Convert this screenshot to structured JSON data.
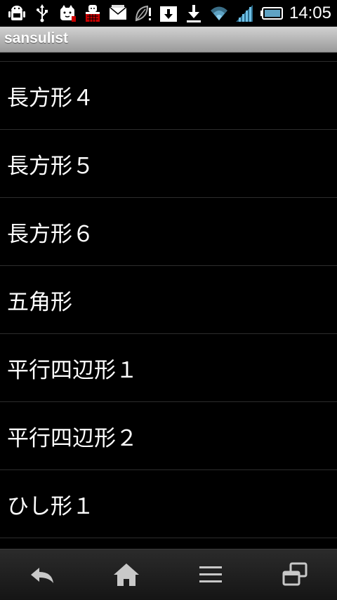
{
  "status_bar": {
    "time": "14:05",
    "icons_left": [
      "android-debug-icon",
      "usb-icon",
      "app-notification-icon",
      "app-notification-icon-2",
      "mail-icon",
      "leaf-alert-icon",
      "download-box-icon",
      "download-icon"
    ],
    "icons_right": [
      "wifi-icon",
      "signal-icon",
      "battery-icon"
    ]
  },
  "title_bar": {
    "title": "sansulist"
  },
  "list": {
    "items": [
      {
        "label": "長方形４"
      },
      {
        "label": "長方形５"
      },
      {
        "label": "長方形６"
      },
      {
        "label": "五角形"
      },
      {
        "label": "平行四辺形１"
      },
      {
        "label": "平行四辺形２"
      },
      {
        "label": "ひし形１"
      }
    ]
  },
  "nav_bar": {
    "buttons": [
      "back-icon",
      "home-icon",
      "menu-icon",
      "recent-apps-icon"
    ]
  },
  "colors": {
    "background": "#000000",
    "title_bar_top": "#d2d2d2",
    "title_bar_bottom": "#9a9a9a",
    "divider": "#2d2d2d",
    "text": "#ffffff"
  }
}
